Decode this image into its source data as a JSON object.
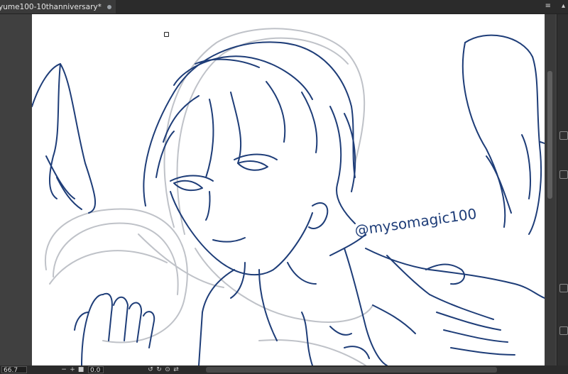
{
  "tab": {
    "title": "yume100-10thanniversary*"
  },
  "canvas": {
    "watermark_text": "@mysomagic100"
  },
  "status": {
    "zoom": "66.7",
    "angle": "0.0"
  },
  "colors": {
    "line": "#1e3d78",
    "sketch": "#b9bcc2",
    "canvas_bg": "#ffffff",
    "ui_bg": "#3c3c3c"
  }
}
